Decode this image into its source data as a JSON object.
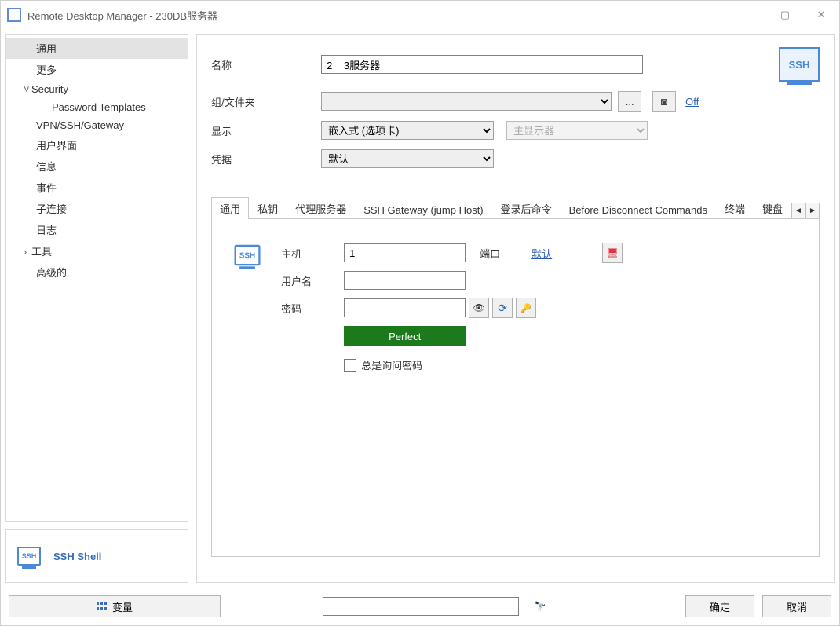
{
  "title": "Remote Desktop Manager - 230DB服务器",
  "sidebar": {
    "items": [
      {
        "label": "通用",
        "depth": 0,
        "selected": true
      },
      {
        "label": "更多",
        "depth": 0
      },
      {
        "label": "Security",
        "depth": 0,
        "chev": "˅"
      },
      {
        "label": "Password Templates",
        "depth": 1
      },
      {
        "label": "VPN/SSH/Gateway",
        "depth": 0
      },
      {
        "label": "用户界面",
        "depth": 0
      },
      {
        "label": "信息",
        "depth": 0
      },
      {
        "label": "事件",
        "depth": 0
      },
      {
        "label": "子连接",
        "depth": 0
      },
      {
        "label": "日志",
        "depth": 0
      },
      {
        "label": "工具",
        "depth": 0,
        "chev": "›"
      },
      {
        "label": "高级的",
        "depth": 0
      }
    ],
    "type_label": "SSH Shell"
  },
  "toprow": {
    "name_lbl": "名称",
    "name_val": "2    3服务器",
    "group_lbl": "组/文件夹",
    "group_val": "",
    "browse_btn": "...",
    "off_link": "Off",
    "display_lbl": "显示",
    "display_val": "嵌入式 (选项卡)",
    "monitor_val": "主显示器",
    "cred_lbl": "凭据",
    "cred_val": "默认",
    "type_badge": "SSH"
  },
  "tabs": [
    "通用",
    "私钥",
    "代理服务器",
    "SSH Gateway (jump Host)",
    "登录后命令",
    "Before Disconnect Commands",
    "终端",
    "键盘"
  ],
  "active_tab": 0,
  "ssh": {
    "host_lbl": "主机",
    "host_val": "1",
    "port_lbl": "端口",
    "port_link": "默认",
    "user_lbl": "用户名",
    "user_val": "",
    "pass_lbl": "密码",
    "pass_val": "",
    "strength": "Perfect",
    "always_ask": "总是询问密码"
  },
  "footer": {
    "variables": "变量",
    "ok": "确定",
    "cancel": "取消"
  }
}
